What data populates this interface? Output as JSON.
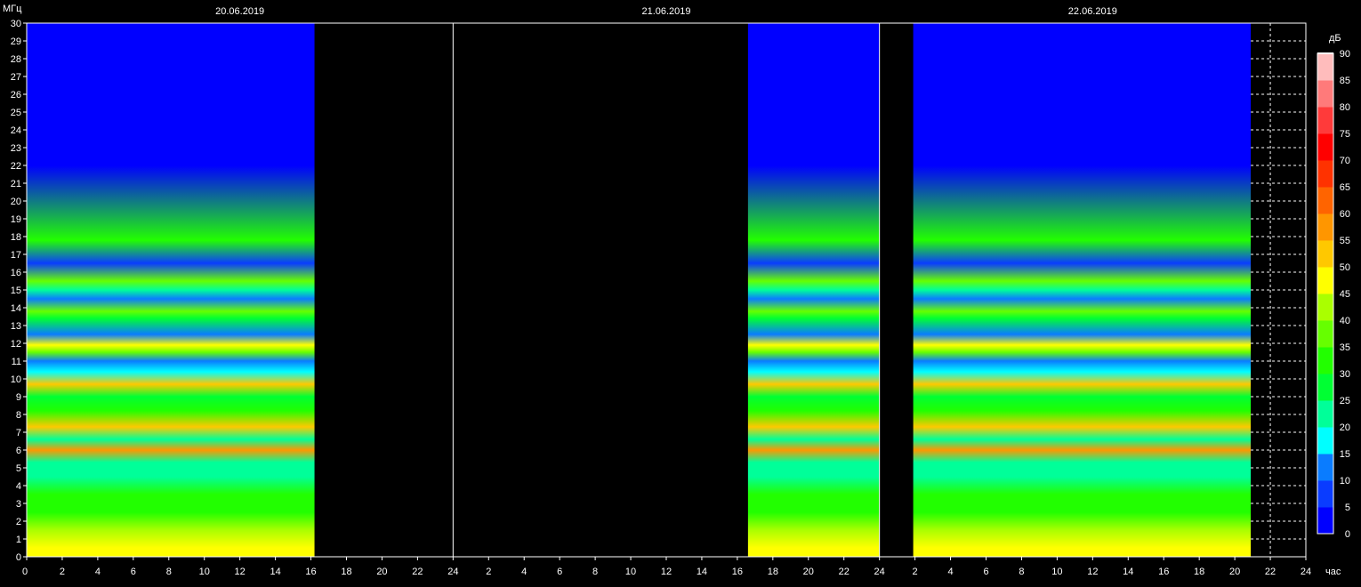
{
  "chart_data": {
    "type": "heatmap",
    "title": "",
    "y_unit": "МГц",
    "x_unit": "час",
    "ylim": [
      0,
      30
    ],
    "y_ticks": [
      0,
      1,
      2,
      3,
      4,
      5,
      6,
      7,
      8,
      9,
      10,
      11,
      12,
      13,
      14,
      15,
      16,
      17,
      18,
      19,
      20,
      21,
      22,
      23,
      24,
      25,
      26,
      27,
      28,
      29,
      30
    ],
    "x_tick_labels": [
      "0",
      "2",
      "4",
      "6",
      "8",
      "10",
      "12",
      "14",
      "16",
      "18",
      "20",
      "22",
      "24",
      "2",
      "4",
      "6",
      "8",
      "10",
      "12",
      "14",
      "16",
      "18",
      "20",
      "22",
      "24",
      "2",
      "4",
      "6",
      "8",
      "10",
      "12",
      "14",
      "16",
      "18",
      "20",
      "22",
      "24"
    ],
    "days": [
      {
        "date": "20.06.2019",
        "data_hours": [
          0,
          16.2
        ]
      },
      {
        "date": "21.06.2019",
        "data_hours": [
          16.6,
          24
        ]
      },
      {
        "date": "22.06.2019",
        "data_hours": [
          1.9,
          20.9
        ]
      }
    ],
    "colorbar": {
      "unit": "дБ",
      "levels": [
        0,
        5,
        10,
        15,
        20,
        25,
        30,
        35,
        40,
        45,
        50,
        55,
        60,
        65,
        70,
        75,
        80,
        85,
        90
      ],
      "colors": [
        "#0000ff",
        "#0a3cff",
        "#0a7cff",
        "#00ffff",
        "#00ff99",
        "#00ff33",
        "#22ff00",
        "#66ff00",
        "#aaff00",
        "#ffff00",
        "#ffc800",
        "#ff9600",
        "#ff6400",
        "#ff3200",
        "#ff0000",
        "#ff3a3a",
        "#ff7a7a",
        "#ffbcbc",
        "#ffffff"
      ]
    },
    "bands_mhz": [
      {
        "mhz": 0.5,
        "db": 45
      },
      {
        "mhz": 1.5,
        "db": 40
      },
      {
        "mhz": 2.5,
        "db": 32
      },
      {
        "mhz": 3.5,
        "db": 28
      },
      {
        "mhz": 4.5,
        "db": 20
      },
      {
        "mhz": 5.3,
        "db": 22
      },
      {
        "mhz": 6.0,
        "db": 55
      },
      {
        "mhz": 6.6,
        "db": 22
      },
      {
        "mhz": 7.3,
        "db": 50
      },
      {
        "mhz": 8.2,
        "db": 30
      },
      {
        "mhz": 9.0,
        "db": 27
      },
      {
        "mhz": 9.7,
        "db": 50
      },
      {
        "mhz": 10.4,
        "db": 15
      },
      {
        "mhz": 11.0,
        "db": 10
      },
      {
        "mhz": 11.5,
        "db": 35
      },
      {
        "mhz": 11.9,
        "db": 45
      },
      {
        "mhz": 12.5,
        "db": 10
      },
      {
        "mhz": 13.4,
        "db": 25
      },
      {
        "mhz": 13.8,
        "db": 35
      },
      {
        "mhz": 14.5,
        "db": 12
      },
      {
        "mhz": 15.0,
        "db": 20
      },
      {
        "mhz": 15.5,
        "db": 35
      },
      {
        "mhz": 16.5,
        "db": 3
      },
      {
        "mhz": 17.8,
        "db": 30
      },
      {
        "mhz": 22,
        "db": 0
      },
      {
        "mhz": 28,
        "db": 0
      }
    ]
  }
}
